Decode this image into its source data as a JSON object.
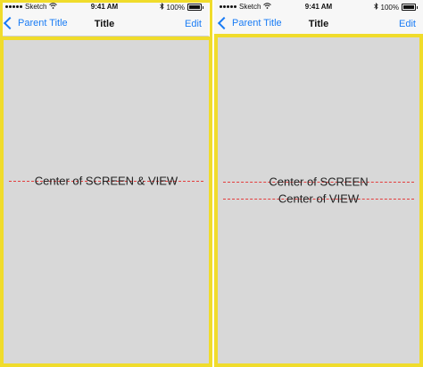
{
  "status_bar": {
    "carrier": "Sketch",
    "time": "9:41 AM",
    "battery": "100%"
  },
  "nav_bar": {
    "back_label": "Parent Title",
    "title": "Title",
    "edit_label": "Edit"
  },
  "left_panel": {
    "label": "Center of SCREEN & VIEW"
  },
  "right_panel": {
    "screen_label": "Center of SCREEN",
    "view_label": "Center of VIEW"
  },
  "colors": {
    "accent": "#1a7cf5",
    "highlight_border": "#f0dc2b",
    "dashed_line": "#e43c3c",
    "content_bg": "#d8d8d8"
  }
}
